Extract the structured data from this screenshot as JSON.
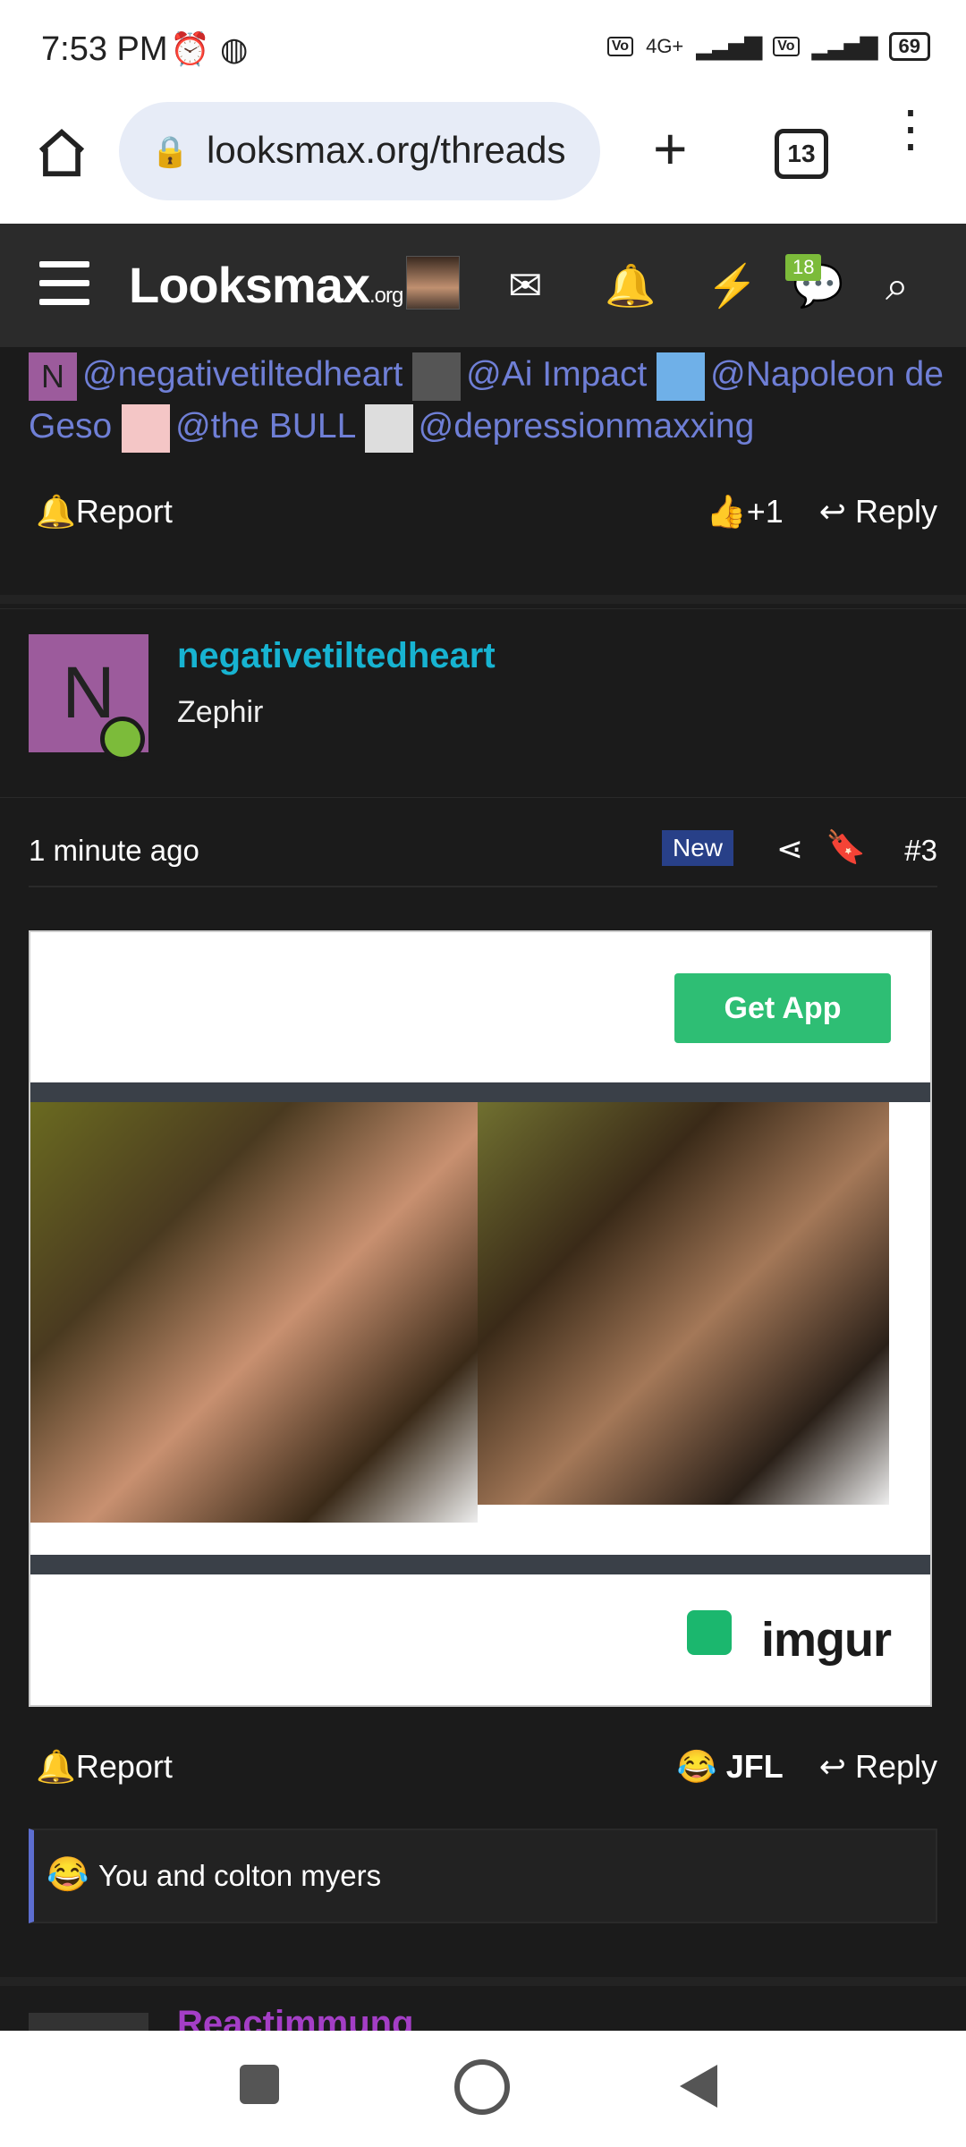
{
  "status": {
    "time": "7:53 PM",
    "network": "4G+",
    "battery": "69"
  },
  "browser": {
    "url": "looksmax.org/threads",
    "tab_count": "13"
  },
  "site": {
    "logo": "Looksmax",
    "logo_suffix": ".org",
    "conversations_badge": "18"
  },
  "mentions": [
    {
      "label": "@negativetiltedheart"
    },
    {
      "label": "@Ai Impact"
    },
    {
      "label": "@Napoleon de Geso"
    },
    {
      "label": "@the BULL"
    },
    {
      "label": "@depressionmaxxing"
    }
  ],
  "post1": {
    "report": "Report",
    "reaction": "+1",
    "reply": "Reply"
  },
  "user": {
    "initial": "N",
    "name": "negativetiltedheart",
    "title": "Zephir"
  },
  "post2": {
    "time": "1 minute ago",
    "badge": "New",
    "number": "#3",
    "get_app": "Get App",
    "embed_brand": "imgur",
    "report": "Report",
    "reaction_emoji": "😂",
    "reaction": "JFL",
    "reply": "Reply",
    "quote": "You and colton myers"
  },
  "next_user_partial": "Reactimmung"
}
